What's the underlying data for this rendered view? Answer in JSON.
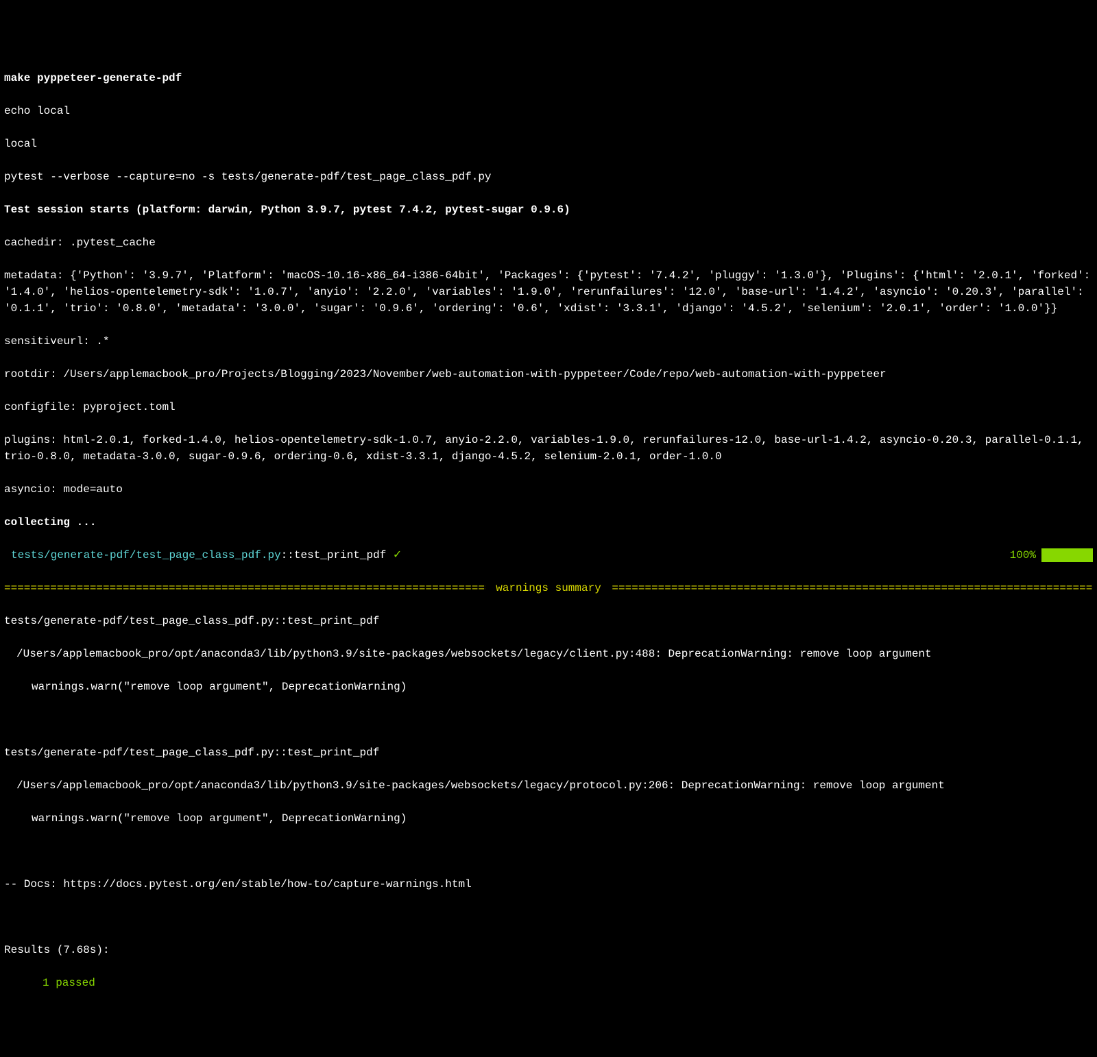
{
  "command": "make pyppeteer-generate-pdf",
  "echo_line": "echo local",
  "local_line": "local",
  "pytest_cmd": "pytest --verbose --capture=no -s tests/generate-pdf/test_page_class_pdf.py",
  "session_header": "Test session starts (platform: darwin, Python 3.9.7, pytest 7.4.2, pytest-sugar 0.9.6)",
  "cachedir": "cachedir: .pytest_cache",
  "metadata": "metadata: {'Python': '3.9.7', 'Platform': 'macOS-10.16-x86_64-i386-64bit', 'Packages': {'pytest': '7.4.2', 'pluggy': '1.3.0'}, 'Plugins': {'html': '2.0.1', 'forked': '1.4.0', 'helios-opentelemetry-sdk': '1.0.7', 'anyio': '2.2.0', 'variables': '1.9.0', 'rerunfailures': '12.0', 'base-url': '1.4.2', 'asyncio': '0.20.3', 'parallel': '0.1.1', 'trio': '0.8.0', 'metadata': '3.0.0', 'sugar': '0.9.6', 'ordering': '0.6', 'xdist': '3.3.1', 'django': '4.5.2', 'selenium': '2.0.1', 'order': '1.0.0'}}",
  "sensitiveurl": "sensitiveurl: .*",
  "rootdir": "rootdir: /Users/applemacbook_pro/Projects/Blogging/2023/November/web-automation-with-pyppeteer/Code/repo/web-automation-with-pyppeteer",
  "configfile": "configfile: pyproject.toml",
  "plugins": "plugins: html-2.0.1, forked-1.4.0, helios-opentelemetry-sdk-1.0.7, anyio-2.2.0, variables-1.9.0, rerunfailures-12.0, base-url-1.4.2, asyncio-0.20.3, parallel-0.1.1, trio-0.8.0, metadata-3.0.0, sugar-0.9.6, ordering-0.6, xdist-3.3.1, django-4.5.2, selenium-2.0.1, order-1.0.0",
  "asyncio_mode": "asyncio: mode=auto",
  "collecting": "collecting ...",
  "test_file": "tests/generate-pdf/test_page_class_pdf.py",
  "test_sep": "::test_print_pdf ",
  "test_check": "✓",
  "test_percent": "100%",
  "warnings_label": " warnings summary ",
  "rule": "======================================================================================================================================",
  "warn1_header": "tests/generate-pdf/test_page_class_pdf.py::test_print_pdf",
  "warn1_path": "/Users/applemacbook_pro/opt/anaconda3/lib/python3.9/site-packages/websockets/legacy/client.py:488: DeprecationWarning: remove loop argument",
  "warn1_code": "warnings.warn(\"remove loop argument\", DeprecationWarning)",
  "warn2_header": "tests/generate-pdf/test_page_class_pdf.py::test_print_pdf",
  "warn2_path": "/Users/applemacbook_pro/opt/anaconda3/lib/python3.9/site-packages/websockets/legacy/protocol.py:206: DeprecationWarning: remove loop argument",
  "warn2_code": "warnings.warn(\"remove loop argument\", DeprecationWarning)",
  "docs_line": "-- Docs: https://docs.pytest.org/en/stable/how-to/capture-warnings.html",
  "results_header": "Results (7.68s):",
  "passed_count": "1 passed"
}
